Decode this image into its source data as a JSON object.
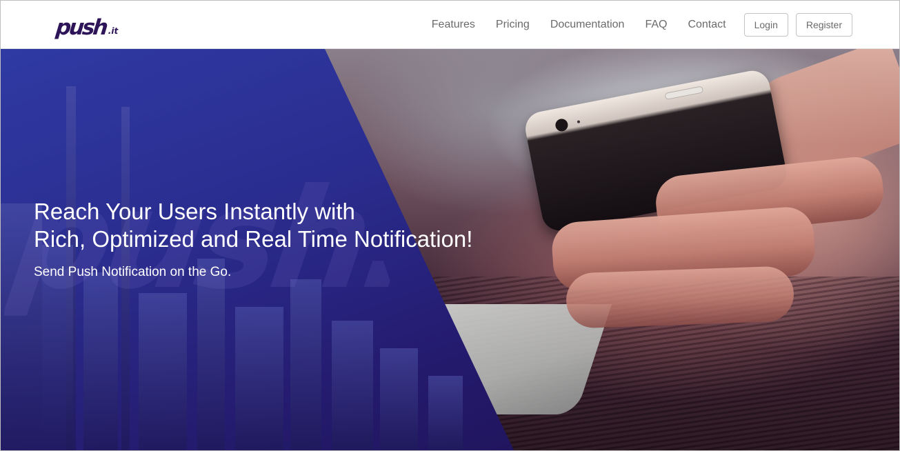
{
  "navbar": {
    "logo": {
      "main": "push",
      "suffix": ".it"
    },
    "links": [
      {
        "label": "Features"
      },
      {
        "label": "Pricing"
      },
      {
        "label": "Documentation"
      },
      {
        "label": "FAQ"
      },
      {
        "label": "Contact"
      }
    ],
    "login_label": "Login",
    "register_label": "Register"
  },
  "hero": {
    "title_line1": "Reach Your Users Instantly with",
    "title_line2": "Rich, Optimized and Real Time Notification!",
    "subtitle": "Send Push Notification on the Go.",
    "watermark": "push.it"
  },
  "colors": {
    "brand": "#2e1458",
    "overlay_blue": "#2a2c8e",
    "nav_text": "#6b6b6b"
  }
}
